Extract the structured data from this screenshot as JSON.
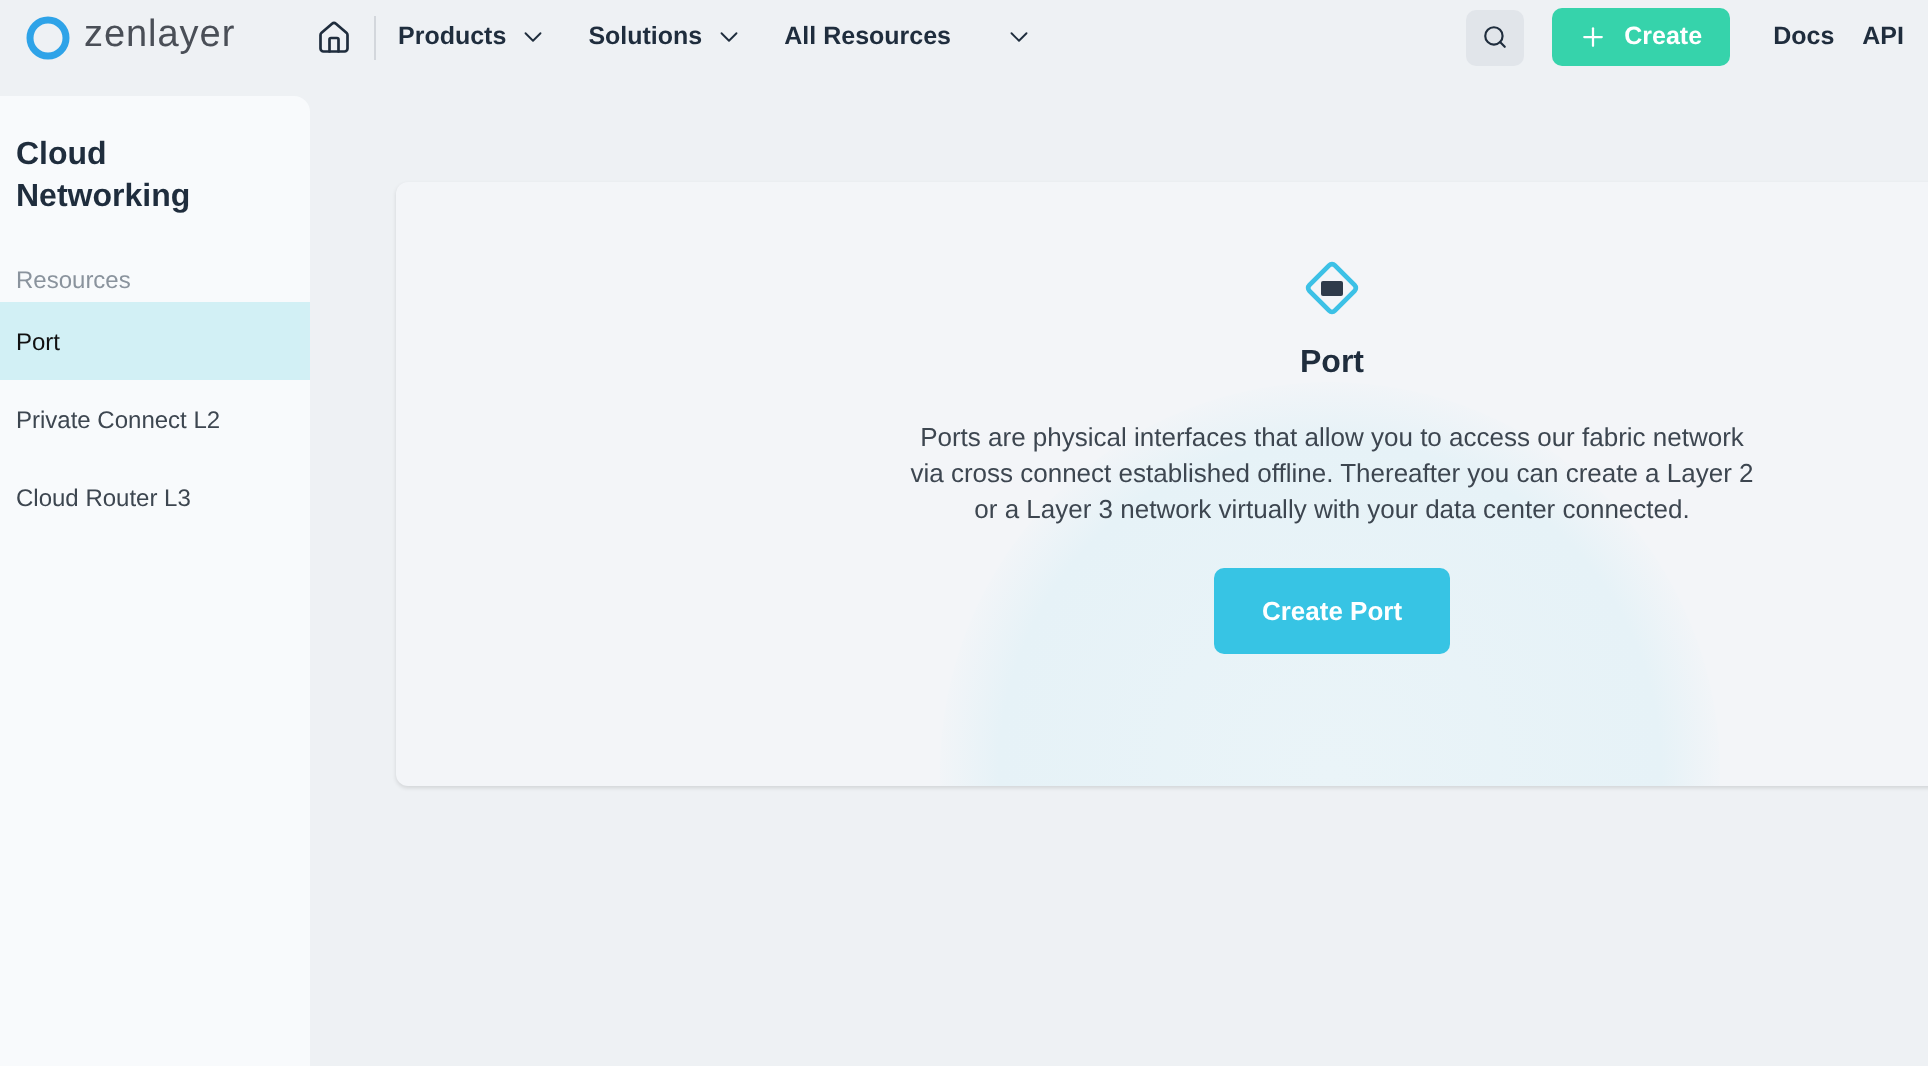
{
  "header": {
    "logo": "zenlayer",
    "nav": [
      {
        "label": "Products"
      },
      {
        "label": "Solutions"
      },
      {
        "label": "All Resources"
      }
    ],
    "create_button": "Create",
    "links": [
      "Docs",
      "API"
    ]
  },
  "sidebar": {
    "title": "Cloud Networking",
    "section": "Resources",
    "items": [
      {
        "label": "Port",
        "selected": true
      },
      {
        "label": "Private Connect L2",
        "selected": false
      },
      {
        "label": "Cloud Router L3",
        "selected": false
      }
    ]
  },
  "empty_state": {
    "title": "Port",
    "description": "Ports are physical interfaces that allow you to access our fabric network via cross connect established offline. Thereafter you can create a Layer 2 or a Layer 3 network virtually with your data center connected.",
    "button": "Create Port"
  }
}
